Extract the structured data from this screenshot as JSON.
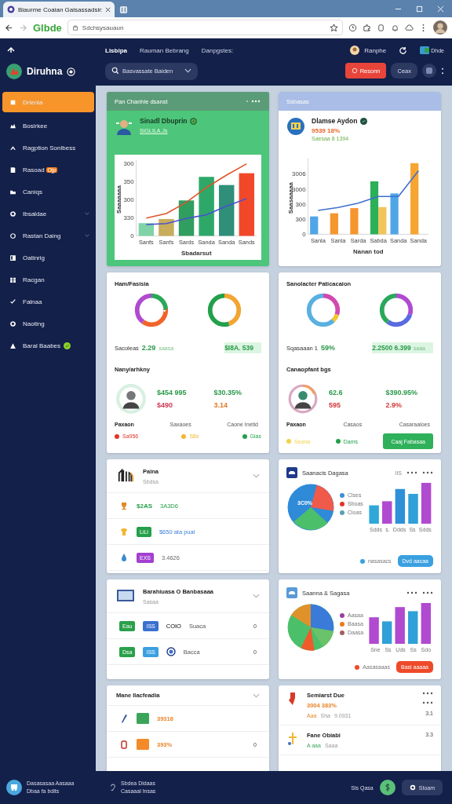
{
  "browser": {
    "tab_title": "Biaurme Coaian Gaisassadsir:",
    "brand": "Glbde",
    "address": "Sdchsysauaun"
  },
  "header": {
    "app_name": "Diruhna",
    "nav": [
      {
        "label": "Lisbipa",
        "selected": true
      },
      {
        "label": "Rauman Bebrang",
        "selected": false
      },
      {
        "label": "Danpgstes:",
        "selected": false
      }
    ],
    "user_name": "Ranphe",
    "badge_label": "Dhde",
    "search_placeholder": "Basvassate Baiden",
    "primary_button": "Resonn",
    "secondary_button": "Ceax"
  },
  "sidebar": {
    "items": [
      {
        "label": "Drlenla",
        "selected": true,
        "expandable": false,
        "status_dot": false
      },
      {
        "label": "Bosirkee",
        "selected": false,
        "expandable": false,
        "status_dot": false
      },
      {
        "label": "Ragption Sonlbess",
        "selected": false,
        "expandable": false,
        "status_dot": false
      },
      {
        "label": "Rasoad",
        "badge": "Ojp",
        "selected": false,
        "expandable": false,
        "status_dot": false
      },
      {
        "label": "Caniqs",
        "selected": false,
        "expandable": false,
        "status_dot": false
      },
      {
        "label": "Ibsaldae",
        "selected": false,
        "expandable": true,
        "status_dot": false
      },
      {
        "label": "Rastan Daing",
        "selected": false,
        "expandable": true,
        "status_dot": false
      },
      {
        "label": "Oatinrig",
        "selected": false,
        "expandable": false,
        "status_dot": false
      },
      {
        "label": "Racgan",
        "selected": false,
        "expandable": false,
        "status_dot": false
      },
      {
        "label": "Falnaa",
        "selected": false,
        "expandable": false,
        "status_dot": false
      },
      {
        "label": "Naoting",
        "selected": false,
        "expandable": false,
        "status_dot": false
      },
      {
        "label": "Baral Baabes",
        "selected": false,
        "expandable": false,
        "status_dot": true
      }
    ]
  },
  "revenue_card": {
    "header": "Pan Chanhle dsanst",
    "name": "Sinadl Dbuprin",
    "subtitle": "SIGLILA.Js",
    "chart": {
      "y_labels": [
        "300",
        "350",
        "300",
        "330",
        "0"
      ],
      "x_labels": [
        "Sanfs",
        "Sanfs",
        "Sards",
        "Sanda",
        "Sanda",
        "Sands"
      ],
      "xlabel": "Sbadarsut",
      "ylabel": "Saaaaaaa"
    }
  },
  "growth_card": {
    "header": "Ssbasas",
    "name": "Dlamse Aydon",
    "value": "9539 18%",
    "change": "Saesaa 8 1394",
    "chart": {
      "y_labels": [
        "3006",
        "3000",
        "300",
        "300",
        "0"
      ],
      "x_labels": [
        "Sanla",
        "Sanla",
        "Sarda",
        "Sabda",
        "Sanda",
        "Sanda"
      ],
      "xlabel": "Nanan tod",
      "ylabel": "Saasaaaaa"
    }
  },
  "stat_cards": [
    {
      "title": "Ham/Fasisia",
      "stat_label": "Sacoleas",
      "stat_value": "2.29",
      "stat_note": "saasa",
      "highlight_value": "$I8A. 539",
      "section_title": "Nany/arhkny",
      "metrics": [
        {
          "value": "$454 995",
          "change": "$490"
        },
        {
          "value": "$30.35%",
          "change": "3.14"
        }
      ],
      "captions": [
        "Paxaon",
        "Saxaoes",
        "Caone Inetid"
      ],
      "legend": [
        {
          "label": "Sa956",
          "color": "#e0352b"
        },
        {
          "label": "S8s",
          "color": "#f2b632"
        },
        {
          "label": "Gias",
          "color": "#22a04b"
        }
      ]
    },
    {
      "title": "Sanolacter Paticacaion",
      "stat_label": "Sqasaaan 1",
      "stat_value": "59%",
      "highlight_value": "2.2500 6.399",
      "highlight_note": "saaa",
      "section_title": "Canaopfant bgs",
      "metrics": [
        {
          "value": "62.6",
          "change": "595"
        },
        {
          "value": "$390.95%",
          "change": "2.9%"
        }
      ],
      "captions": [
        "Paxaon",
        "Casaos",
        "Casaraaloes"
      ],
      "legend": [
        {
          "label": "Seana",
          "color": "#f2d24a"
        },
        {
          "label": "Dams",
          "color": "#22a04b"
        }
      ],
      "button": "Caaj Fabasaa"
    }
  ],
  "list_card": {
    "title": "Paina",
    "subtitle": "Sbdsa",
    "rows": [
      {
        "badge": "$2AS",
        "kind": "text",
        "color": "#25a04a",
        "text": "3A3D6"
      },
      {
        "badge": "LiLi",
        "kind": "tag",
        "color": "#25a04a",
        "text": "$650 ata pual"
      },
      {
        "badge": "EXS",
        "kind": "tag",
        "color": "#a33fd0",
        "text": "3.4626"
      }
    ]
  },
  "chart_cards": [
    {
      "title": "Saanacis Dagasa",
      "meta": "IIS",
      "pie_label": "3C0%",
      "color": "#3aa0e0",
      "legend": [
        {
          "label": "Cises",
          "color": "#3b8fd9"
        },
        {
          "label": "Sboas",
          "color": "#e0352b"
        },
        {
          "label": "Cioas",
          "color": "#5aa0b0"
        }
      ],
      "bar_labels": [
        "Sdds",
        "s.",
        "Ddds",
        "Ss",
        "Sdds"
      ],
      "footer_label": "nasasacs",
      "button": "Dvd aacaa"
    },
    {
      "title": "Saanna & Sagasa",
      "color": "#ee4a2a",
      "legend": [
        {
          "label": "Aasaa",
          "color": "#9a3fa0"
        },
        {
          "label": "Baasa",
          "color": "#f07a1a"
        },
        {
          "label": "Daasa",
          "color": "#a06060"
        }
      ],
      "bar_labels": [
        "Sne",
        "Ss",
        "Uds",
        "Ss",
        "Sdo"
      ],
      "footer_label": "Aasasaaas",
      "button": "Basi aaaaa"
    }
  ],
  "device_card": {
    "title": "Barahiuasa O Banbasaaa",
    "subtitle": "Sasaa",
    "rows": [
      {
        "tag": "Eau",
        "code": "ISS",
        "kind": "code",
        "label": "COIO",
        "name": "Suaca",
        "count": "0"
      },
      {
        "tag": "Dsa",
        "code": "ISS",
        "kind": "coin",
        "name": "Bacca",
        "count": "0"
      }
    ]
  },
  "media_card": {
    "title": "Mane Ilacfeadia",
    "rows": [
      {
        "value": "39316",
        "color": "#3aa55a"
      },
      {
        "value": "393%",
        "color": "#f28a2a",
        "count": "0"
      }
    ]
  },
  "activity_card": {
    "items": [
      {
        "title": "Semiarst Due",
        "value": "3004 383%",
        "meta": [
          "Aaa",
          "Sha",
          "9.0931"
        ],
        "count": "3.1"
      },
      {
        "title": "Fane Obiabi",
        "meta": [
          "A aaa",
          "Saaa"
        ],
        "count": "3.3"
      }
    ]
  },
  "footer": {
    "left_title": "Dasasasaa Aasaaa",
    "left_sub": "Dbaa fa bdits",
    "mid_title": "Sbdea Didaas",
    "mid_sub": "Casaaal Insas",
    "status": "Sls Qasa",
    "button": "Stoam"
  }
}
